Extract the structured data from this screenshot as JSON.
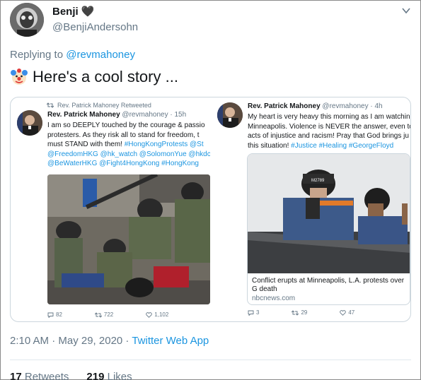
{
  "tweet": {
    "author_name": "Benji",
    "author_emoji": "heart-icon",
    "author_handle": "@BenjiAndersohn",
    "replying_prefix": "Replying to",
    "replying_to": "@revmahoney",
    "text": "Here's a cool story ...",
    "timestamp": "2:10 AM · May 29, 2020 · ",
    "source": "Twitter Web App",
    "retweets_count": "17",
    "retweets_label": "Retweets",
    "likes_count": "219",
    "likes_label": "Likes"
  },
  "embed_left": {
    "retweet_label": "Rev. Patrick Mahoney Retweeted",
    "name": "Rev. Patrick Mahoney",
    "handle": "@revmahoney · 15h",
    "lines": [
      "I am so DEEPLY touched by the courage & passio",
      "protesters. As they risk all to stand for freedom, t",
      "must STAND with them! "
    ],
    "tags_line3": "#HongKongProtests @St",
    "tags_line4": "@FreedomHKG @hk_watch @SolomonYue @hkdc",
    "tags_line5": "@BeWaterHKG @Fight4HongKong #HongKong",
    "replies": "82",
    "retweets": "722",
    "likes": "1,102"
  },
  "embed_right": {
    "name": "Rev. Patrick Mahoney",
    "handle": "@revmahoney · 4h",
    "lines": [
      "My heart is very heavy this morning as I am watchin",
      "Minneapolis. Violence is NEVER the answer, even to",
      "acts of injustice and racism! Pray that God brings ju",
      "this situation! "
    ],
    "tags_line4": "#Justice #Healing #GeorgeFloyd",
    "card_title": "Conflict erupts at Minneapolis, L.A. protests over G death",
    "card_domain": "nbcnews.com",
    "helmet_label": "M2789",
    "replies": "3",
    "retweets": "29",
    "likes": "47"
  },
  "colors": {
    "link": "#1b95e0",
    "muted": "#657786",
    "border": "#ccd6dd"
  }
}
